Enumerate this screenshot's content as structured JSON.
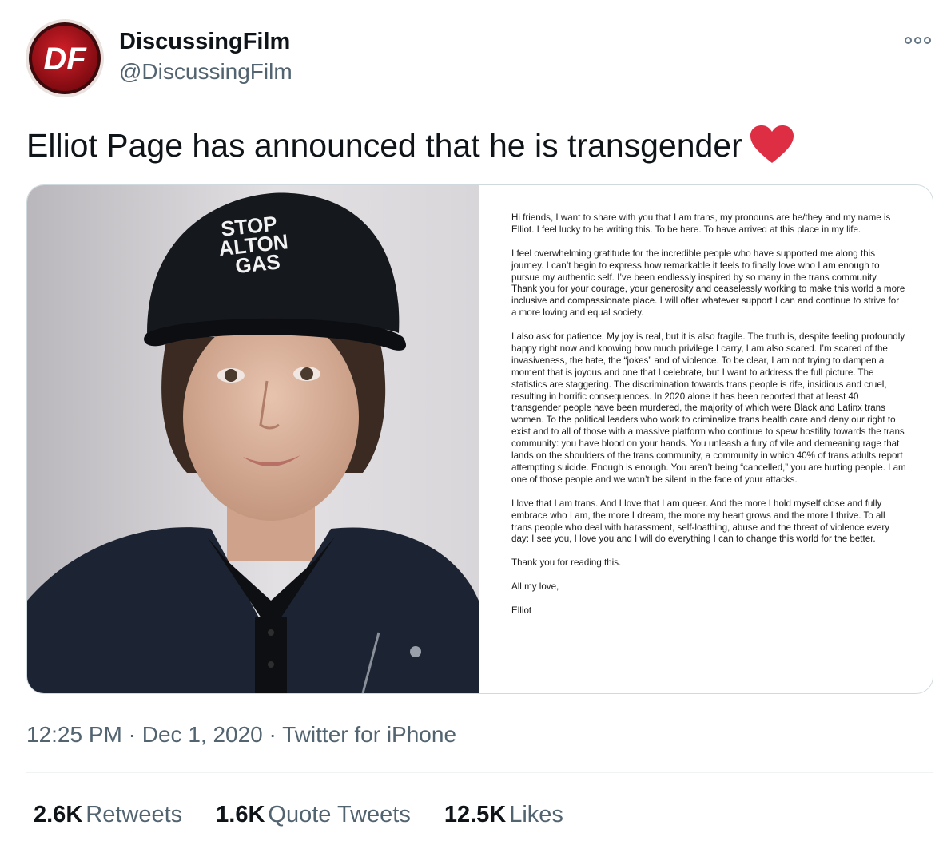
{
  "header": {
    "display_name": "DiscussingFilm",
    "handle": "@DiscussingFilm",
    "avatar_text": "DF",
    "avatar_color": "#b3121c"
  },
  "tweet": {
    "text": "Elliot Page has announced that he is transgender",
    "emoji": "heart-icon"
  },
  "media": {
    "cap_text": [
      "STOP",
      "ALTON",
      "GAS"
    ],
    "letter_paragraphs": [
      "Hi friends, I want to share with you that I am trans, my pronouns are he/they and my name is Elliot. I feel lucky to be writing this. To be here. To have arrived at this place in my life.",
      "I feel overwhelming gratitude for the incredible people who have supported me along this journey. I can’t begin to express how remarkable it feels to finally love who I am enough to pursue my authentic self. I’ve been endlessly inspired by so many in the trans community. Thank you for your courage, your generosity and ceaselessly working to make this world a more inclusive and compassionate place. I will offer whatever support I can and continue to strive for a more loving and equal society.",
      "I also ask for patience. My joy is real, but it is also fragile. The truth is, despite feeling profoundly happy right now and knowing how much privilege I carry, I am also scared. I’m scared of the invasiveness, the hate, the “jokes” and of violence. To be clear, I am not trying to dampen a moment that is joyous and one that I celebrate, but I want to address the full picture. The statistics are staggering. The discrimination towards trans people is rife, insidious and cruel, resulting in horrific consequences. In 2020 alone it has been reported that at least 40 transgender people have been murdered, the majority of which were Black and Latinx trans women. To the political leaders who work to criminalize trans health care and deny our right to exist and to all of those with a massive platform who continue to spew hostility towards the trans community: you have blood on your hands. You unleash a fury of vile and demeaning rage that lands on the shoulders of the trans community, a community in which 40% of trans adults report attempting suicide. Enough is enough. You aren’t being “cancelled,” you are hurting people. I am one of those people and we won’t be silent in the face of your attacks.",
      "I love that I am trans. And I love that I am queer. And the more I hold myself close and fully embrace who I am, the more I dream, the more my heart grows and the more I thrive. To all trans people who deal with harassment, self-loathing, abuse and the threat of violence every day: I see you, I love you and I will do everything I can to change this world for the better.",
      "Thank you for reading this.",
      "All my love,",
      "Elliot"
    ]
  },
  "footer": {
    "time": "12:25 PM",
    "separator": "·",
    "date": "Dec 1, 2020",
    "source": "Twitter for iPhone"
  },
  "stats": {
    "retweets_count": "2.6K",
    "retweets_label": "Retweets",
    "quotes_count": "1.6K",
    "quotes_label": "Quote Tweets",
    "likes_count": "12.5K",
    "likes_label": "Likes"
  },
  "colors": {
    "heart": "#dd2e44",
    "secondary_text": "#536471",
    "border": "#cfd9de"
  }
}
